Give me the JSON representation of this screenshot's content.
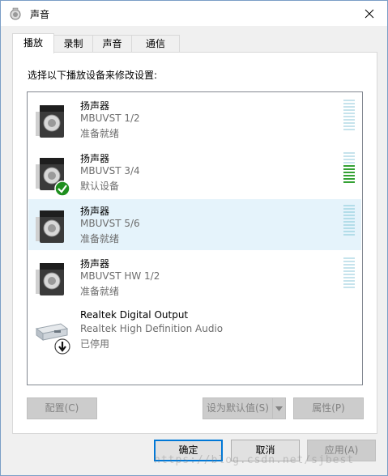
{
  "window": {
    "title": "声音"
  },
  "tabs": [
    {
      "label": "播放",
      "active": true
    },
    {
      "label": "录制",
      "active": false
    },
    {
      "label": "声音",
      "active": false
    },
    {
      "label": "通信",
      "active": false
    }
  ],
  "instruction": "选择以下播放设备来修改设置:",
  "devices": [
    {
      "name": "扬声器",
      "detail": "MBUVST 1/2",
      "status": "准备就绪",
      "icon": "speaker-icon",
      "default": false,
      "selected": false,
      "level": 0
    },
    {
      "name": "扬声器",
      "detail": "MBUVST 3/4",
      "status": "默认设备",
      "icon": "speaker-icon",
      "default": true,
      "selected": false,
      "level": 0.55
    },
    {
      "name": "扬声器",
      "detail": "MBUVST 5/6",
      "status": "准备就绪",
      "icon": "speaker-icon",
      "default": false,
      "selected": true,
      "level": 0
    },
    {
      "name": "扬声器",
      "detail": "MBUVST HW 1/2",
      "status": "准备就绪",
      "icon": "speaker-icon",
      "default": false,
      "selected": false,
      "level": 0
    },
    {
      "name": "Realtek Digital Output",
      "detail": "Realtek High Definition Audio",
      "status": "已停用",
      "icon": "digital-output-icon",
      "default": false,
      "selected": false,
      "level": null
    }
  ],
  "buttons": {
    "configure": "配置(C)",
    "set_default": "设为默认值(S)",
    "properties": "属性(P)",
    "ok": "确定",
    "cancel": "取消",
    "apply": "应用(A)"
  },
  "watermark": "https://blog.csdn.net/sjbest",
  "colors": {
    "accent": "#0078d7",
    "default_check": "#1e8f1e",
    "meter_active": "#34a134"
  }
}
